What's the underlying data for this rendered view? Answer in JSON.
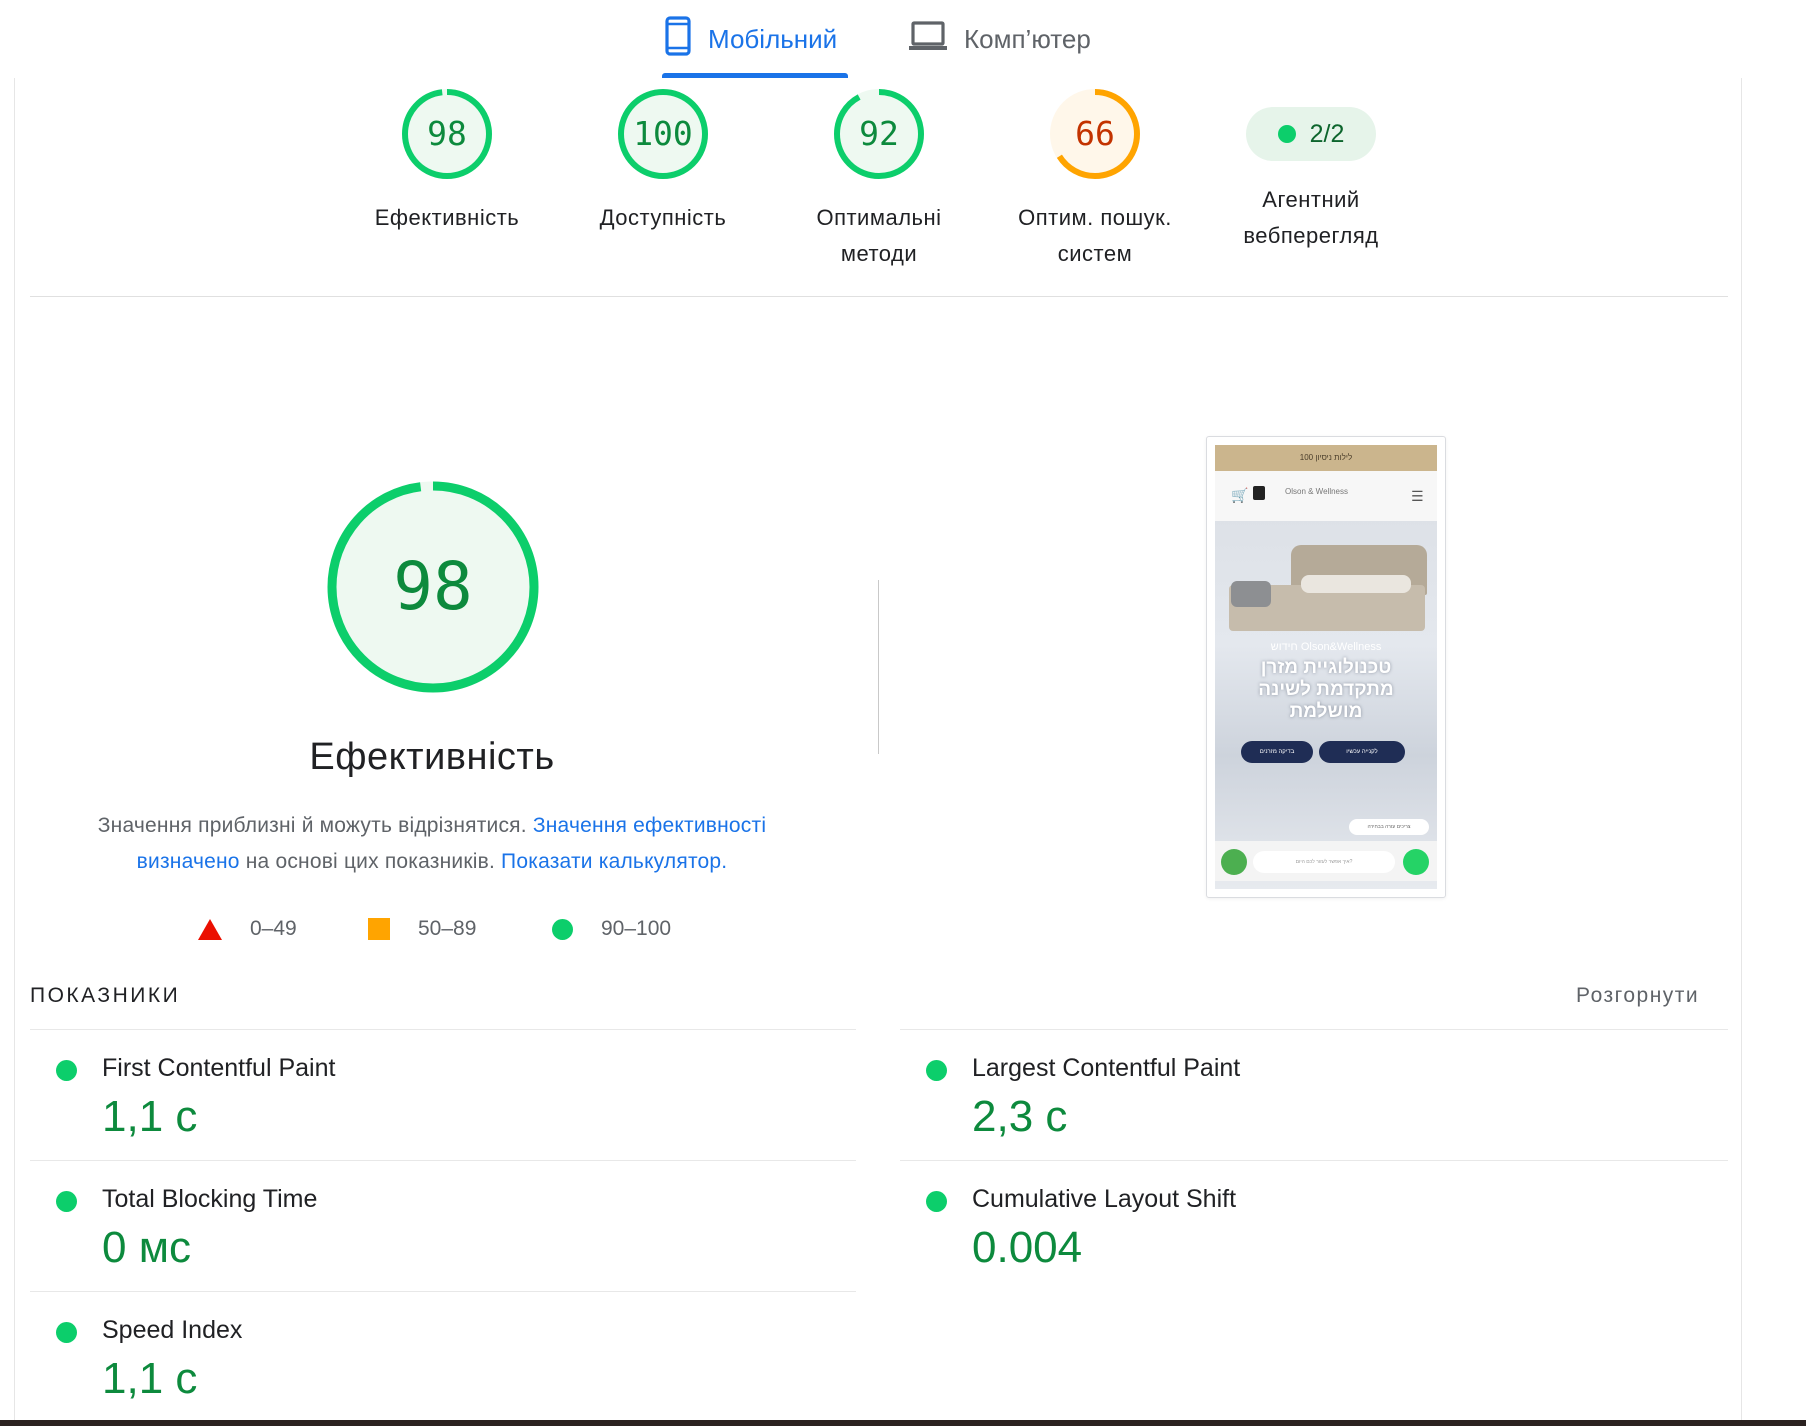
{
  "tabs": [
    {
      "label": "Мобільний",
      "icon": "smartphone-icon",
      "active": true
    },
    {
      "label": "Комп’ютер",
      "icon": "laptop-icon",
      "active": false
    }
  ],
  "colors": {
    "good": "#0cce6b",
    "good_text": "#0d8a3d",
    "average": "#ffa400",
    "average_text": "#c33300",
    "poor": "#eb0f00",
    "accent": "#1a73e8"
  },
  "categories": [
    {
      "score": "98",
      "score_value": 98,
      "label_line1": "Ефективність",
      "label_line2": "",
      "status": "good"
    },
    {
      "score": "100",
      "score_value": 100,
      "label_line1": "Доступність",
      "label_line2": "",
      "status": "good"
    },
    {
      "score": "92",
      "score_value": 92,
      "label_line1": "Оптимальні",
      "label_line2": "методи",
      "status": "good"
    },
    {
      "score": "66",
      "score_value": 66,
      "label_line1": "Оптим. пошук.",
      "label_line2": "систем",
      "status": "average"
    }
  ],
  "agentic": {
    "value": "2/2",
    "label_line1": "Агентний",
    "label_line2": "вебперегляд"
  },
  "performance": {
    "score": "98",
    "score_value": 98,
    "title": "Ефективність",
    "note_part1": "Значення приблизні й можуть відрізнятися.",
    "note_link1": "Значення ефективності визначено",
    "note_part2": "на основі цих показників.",
    "note_link2": "Показати калькулятор."
  },
  "legend": [
    {
      "range": "0–49",
      "shape": "triangle"
    },
    {
      "range": "50–89",
      "shape": "square"
    },
    {
      "range": "90–100",
      "shape": "circle"
    }
  ],
  "thumbnail": {
    "top_banner": "100 לילות ניסיון",
    "brand_small": "Olson & Wellness",
    "brand_line": "חידוש Olson&Wellness",
    "headline": "טכנולוגיית מזרן מתקדמת לשינה מושלמת",
    "button1": "בדיקה מזרנים",
    "button2": "לקנייה עכשיו",
    "chip": "צריכים עזרה בבחירה",
    "input_placeholder": "איך אפשר לעזור לכם היום?"
  },
  "metrics_header": {
    "title": "ПОКАЗНИКИ",
    "expand": "Розгорнути"
  },
  "metrics": [
    {
      "name": "First Contentful Paint",
      "value": "1,1 с"
    },
    {
      "name": "Largest Contentful Paint",
      "value": "2,3 с"
    },
    {
      "name": "Total Blocking Time",
      "value": "0 мс"
    },
    {
      "name": "Cumulative Layout Shift",
      "value": "0.004"
    },
    {
      "name": "Speed Index",
      "value": "1,1 с"
    }
  ]
}
